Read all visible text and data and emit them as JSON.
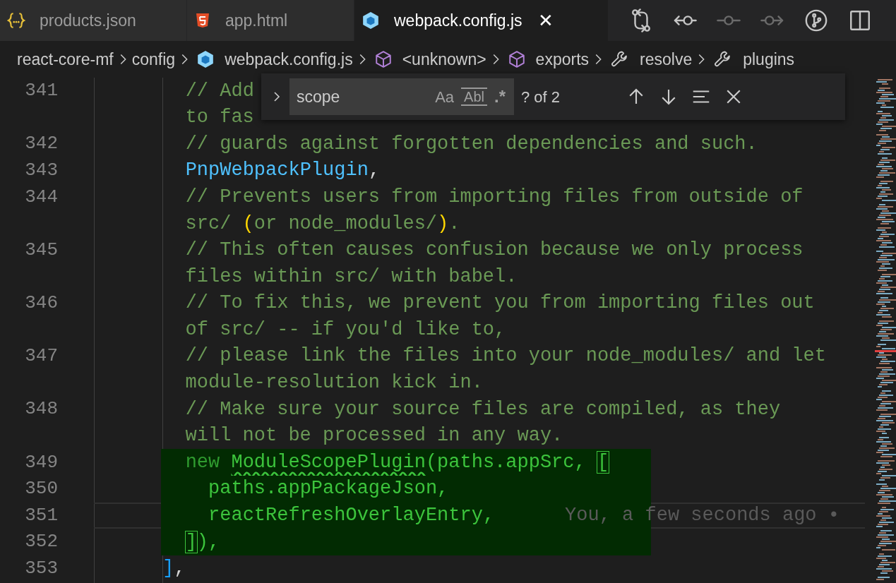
{
  "tabs": [
    {
      "label": "products.json",
      "kind": "json",
      "selected": false
    },
    {
      "label": "app.html",
      "kind": "html",
      "selected": false
    },
    {
      "label": "webpack.config.js",
      "kind": "webpack",
      "selected": true,
      "close": "✕"
    }
  ],
  "toolbar": [
    {
      "kind": "compare",
      "disabled": false
    },
    {
      "kind": "prev",
      "disabled": false
    },
    {
      "kind": "dot",
      "disabled": true
    },
    {
      "kind": "next",
      "disabled": true
    },
    {
      "kind": "branch",
      "disabled": false
    },
    {
      "kind": "split",
      "disabled": false
    }
  ],
  "breadcrumb": [
    {
      "label": "react-core-mf",
      "kind": "folder"
    },
    {
      "label": "config",
      "kind": "folder"
    },
    {
      "label": "webpack.config.js",
      "kind": "webpack"
    },
    {
      "label": "<unknown>",
      "kind": "module"
    },
    {
      "label": "exports",
      "kind": "module"
    },
    {
      "label": "resolve",
      "kind": "property"
    },
    {
      "label": "plugins",
      "kind": "property"
    }
  ],
  "find": {
    "value": "scope",
    "options": [
      "Aa",
      "Abl",
      ".*"
    ],
    "count": "? of 2"
  },
  "lines": [
    {
      "number": "341",
      "rows": [
        [
          {
            "text": "        // Add",
            "kind": "comment"
          }
        ],
        [
          {
            "text": "to fas",
            "kind": "comment"
          }
        ]
      ]
    },
    {
      "number": "342",
      "rows": [
        [
          {
            "text": "        // guards against forgotten dependencies and such.",
            "kind": "comment"
          }
        ]
      ]
    },
    {
      "number": "343",
      "rows": [
        [
          {
            "text": "        PnpWebpackPlugin",
            "kind": "ident"
          },
          {
            "text": ",",
            "kind": "punct"
          }
        ]
      ]
    },
    {
      "number": "344",
      "rows": [
        [
          {
            "text": "        // Prevents users from importing files from outside of",
            "kind": "comment"
          }
        ],
        [
          {
            "text": "src/ ",
            "kind": "comment"
          },
          {
            "text": "(",
            "kind": "bracket_gold"
          },
          {
            "text": "or node_modules/",
            "kind": "comment"
          },
          {
            "text": ")",
            "kind": "bracket_gold"
          },
          {
            "text": ".",
            "kind": "comment"
          }
        ]
      ]
    },
    {
      "number": "345",
      "rows": [
        [
          {
            "text": "        // This often causes confusion because we only process",
            "kind": "comment"
          }
        ],
        [
          {
            "text": "files within src/ with babel.",
            "kind": "comment"
          }
        ]
      ]
    },
    {
      "number": "346",
      "rows": [
        [
          {
            "text": "        // To fix this, we prevent you from importing files out",
            "kind": "comment"
          }
        ],
        [
          {
            "text": "of src/ -- if you'd like to,",
            "kind": "comment"
          }
        ]
      ]
    },
    {
      "number": "347",
      "rows": [
        [
          {
            "text": "        // please link the files into your node_modules/ and let",
            "kind": "comment"
          }
        ],
        [
          {
            "text": "module-resolution kick in.",
            "kind": "comment"
          }
        ]
      ]
    },
    {
      "number": "348",
      "rows": [
        [
          {
            "text": "        // Make sure your source files are compiled, as they",
            "kind": "comment"
          }
        ],
        [
          {
            "text": "will not be processed in any way.",
            "kind": "comment"
          }
        ]
      ]
    },
    {
      "number": "349",
      "highlighted": true,
      "rows": [
        [
          {
            "text": "        new",
            "kind": "added_kw"
          },
          {
            "text": " ",
            "kind": "added"
          },
          {
            "text": "ModuleScopePlugin",
            "kind": "added_error"
          },
          {
            "text": "(paths.appSrc, ",
            "kind": "added"
          },
          {
            "text": "[",
            "kind": "bracket_match"
          }
        ]
      ]
    },
    {
      "number": "350",
      "highlighted": true,
      "rows": [
        [
          {
            "text": "          paths.appPackageJson,",
            "kind": "added"
          }
        ]
      ]
    },
    {
      "number": "351",
      "highlighted": true,
      "current": true,
      "blame": "You, a few seconds ago •",
      "rows": [
        [
          {
            "text": "          reactRefreshOverlayEntry,",
            "kind": "added"
          }
        ]
      ]
    },
    {
      "number": "352",
      "highlighted": true,
      "rows": [
        [
          {
            "text": "        ]",
            "kind": "bracket_match"
          },
          {
            "text": "),",
            "kind": "added"
          }
        ]
      ]
    },
    {
      "number": "353",
      "rows": [
        [
          {
            "text": "      ]",
            "kind": "bracket_blue"
          },
          {
            "text": ",",
            "kind": "punct"
          }
        ]
      ]
    }
  ]
}
